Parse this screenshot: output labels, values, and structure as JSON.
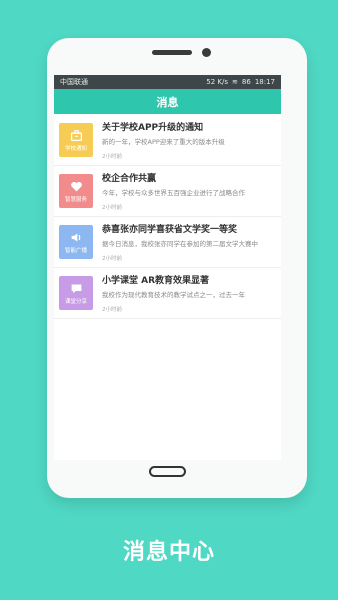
{
  "status": {
    "carrier": "中国联通",
    "speed": "52 K/s",
    "battery": "86",
    "time": "18:17"
  },
  "appbar": {
    "title": "消息"
  },
  "items": [
    {
      "category": "学校通知",
      "color": "#f7cc54",
      "icon": "briefcase-icon",
      "title": "关于学校APP升级的通知",
      "desc": "新的一年，学校APP迎来了重大的版本升级",
      "time": "2小时前"
    },
    {
      "category": "智慧服务",
      "color": "#f28b8b",
      "icon": "heart-icon",
      "title": "校企合作共赢",
      "desc": "今年，学校与众多世界五百强企业进行了战略合作",
      "time": "2小时前"
    },
    {
      "category": "智能广播",
      "color": "#8cb7f0",
      "icon": "speaker-icon",
      "title": "恭喜张亦同学喜获省文学奖一等奖",
      "desc": "据今日消息，我校张亦同学在参加的第二届文学大赛中",
      "time": "2小时前"
    },
    {
      "category": "课堂分享",
      "color": "#c79be6",
      "icon": "chat-icon",
      "title": "小学课堂 AR教育效果显著",
      "desc": "我校作为现代教育技术的教学试点之一，过去一年",
      "time": "2小时前"
    }
  ],
  "caption": "消息中心"
}
